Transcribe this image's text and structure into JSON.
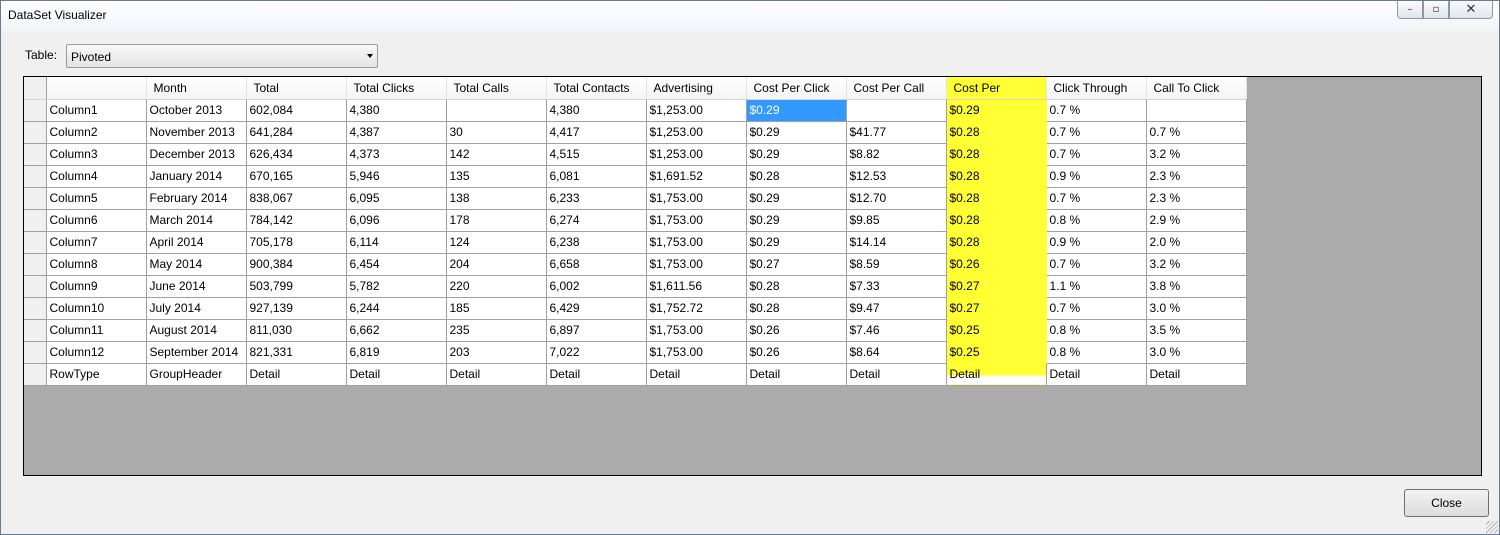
{
  "window": {
    "title": "DataSet Visualizer"
  },
  "title_buttons": {
    "minimize": "–",
    "maximize": "▫",
    "close": "✕"
  },
  "toolbar": {
    "table_label": "Table:",
    "table_selected": "Pivoted"
  },
  "grid": {
    "columns": [
      "",
      "Month",
      "Total",
      "Total Clicks",
      "Total Calls",
      "Total Contacts",
      "Advertising",
      "Cost Per Click",
      "Cost Per Call",
      "Cost Per",
      "Click Through",
      "Call To Click"
    ],
    "rows": [
      [
        "Column1",
        "October 2013",
        "602,084",
        "4,380",
        "",
        "4,380",
        "$1,253.00",
        "$0.29",
        "",
        "$0.29",
        "0.7 %",
        ""
      ],
      [
        "Column2",
        "November 2013",
        "641,284",
        "4,387",
        "30",
        "4,417",
        "$1,253.00",
        "$0.29",
        "$41.77",
        "$0.28",
        "0.7 %",
        "0.7 %"
      ],
      [
        "Column3",
        "December 2013",
        "626,434",
        "4,373",
        "142",
        "4,515",
        "$1,253.00",
        "$0.29",
        "$8.82",
        "$0.28",
        "0.7 %",
        "3.2 %"
      ],
      [
        "Column4",
        "January 2014",
        "670,165",
        "5,946",
        "135",
        "6,081",
        "$1,691.52",
        "$0.28",
        "$12.53",
        "$0.28",
        "0.9 %",
        "2.3 %"
      ],
      [
        "Column5",
        "February 2014",
        "838,067",
        "6,095",
        "138",
        "6,233",
        "$1,753.00",
        "$0.29",
        "$12.70",
        "$0.28",
        "0.7 %",
        "2.3 %"
      ],
      [
        "Column6",
        "March 2014",
        "784,142",
        "6,096",
        "178",
        "6,274",
        "$1,753.00",
        "$0.29",
        "$9.85",
        "$0.28",
        "0.8 %",
        "2.9 %"
      ],
      [
        "Column7",
        "April 2014",
        "705,178",
        "6,114",
        "124",
        "6,238",
        "$1,753.00",
        "$0.29",
        "$14.14",
        "$0.28",
        "0.9 %",
        "2.0 %"
      ],
      [
        "Column8",
        "May 2014",
        "900,384",
        "6,454",
        "204",
        "6,658",
        "$1,753.00",
        "$0.27",
        "$8.59",
        "$0.26",
        "0.7 %",
        "3.2 %"
      ],
      [
        "Column9",
        "June 2014",
        "503,799",
        "5,782",
        "220",
        "6,002",
        "$1,611.56",
        "$0.28",
        "$7.33",
        "$0.27",
        "1.1 %",
        "3.8 %"
      ],
      [
        "Column10",
        "July 2014",
        "927,139",
        "6,244",
        "185",
        "6,429",
        "$1,752.72",
        "$0.28",
        "$9.47",
        "$0.27",
        "0.7 %",
        "3.0 %"
      ],
      [
        "Column11",
        "August 2014",
        "811,030",
        "6,662",
        "235",
        "6,897",
        "$1,753.00",
        "$0.26",
        "$7.46",
        "$0.25",
        "0.8 %",
        "3.5 %"
      ],
      [
        "Column12",
        "September 2014",
        "821,331",
        "6,819",
        "203",
        "7,022",
        "$1,753.00",
        "$0.26",
        "$8.64",
        "$0.25",
        "0.8 %",
        "3.0 %"
      ],
      [
        "RowType",
        "GroupHeader",
        "Detail",
        "Detail",
        "Detail",
        "Detail",
        "Detail",
        "Detail",
        "Detail",
        "Detail",
        "Detail",
        "Detail"
      ]
    ],
    "selected_cell": {
      "row": 0,
      "col": 7
    },
    "highlight_column": 9,
    "highlight_color": "#ffff33",
    "selection_color": "#3399ff",
    "grid_background": "#ababab"
  },
  "footer": {
    "close_label": "Close"
  }
}
